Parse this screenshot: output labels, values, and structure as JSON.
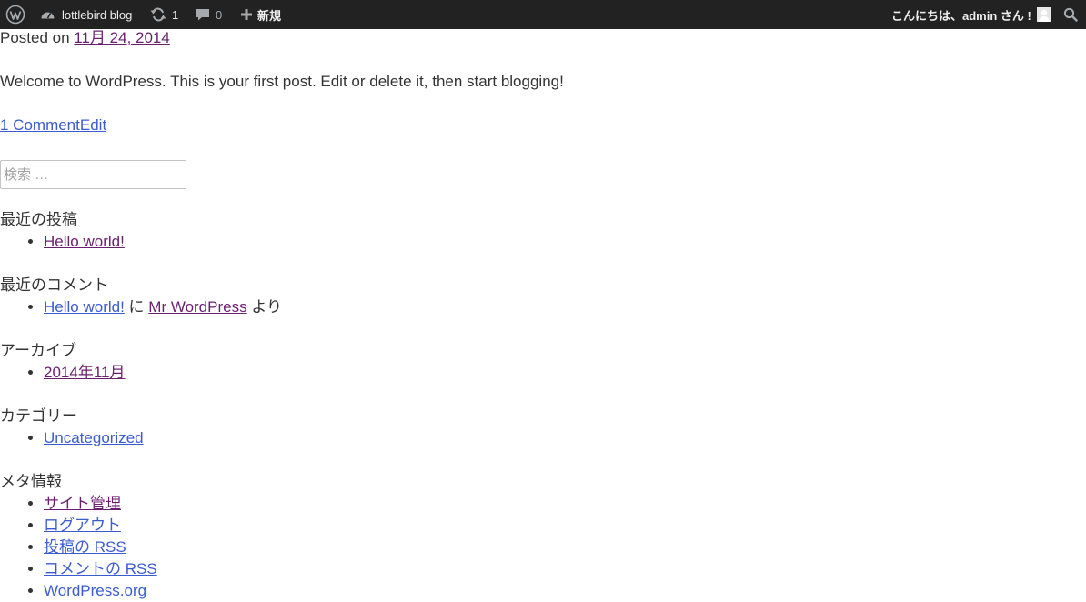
{
  "admin_bar": {
    "site_name": "lottlebird blog",
    "updates_count": "1",
    "comments_count": "0",
    "new_label": "新規",
    "greeting": "こんにちは、admin さん !"
  },
  "post": {
    "posted_on_label": "Posted on",
    "date": "11月 24, 2014",
    "body": "Welcome to WordPress. This is your first post. Edit or delete it, then start blogging!",
    "comment_link": "1 Comment",
    "edit_link": "Edit"
  },
  "search": {
    "placeholder": "検索 …"
  },
  "widgets": {
    "recent_posts": {
      "title": "最近の投稿",
      "items": [
        "Hello world!"
      ]
    },
    "recent_comments": {
      "title": "最近のコメント",
      "post_link": "Hello world!",
      "on_text": "に",
      "author_link": "Mr WordPress",
      "by_text": "より"
    },
    "archives": {
      "title": "アーカイブ",
      "items": [
        "2014年11月"
      ]
    },
    "categories": {
      "title": "カテゴリー",
      "items": [
        "Uncategorized"
      ]
    },
    "meta": {
      "title": "メタ情報",
      "items": [
        "サイト管理",
        "ログアウト",
        "投稿の RSS",
        "コメントの RSS",
        "WordPress.org"
      ]
    }
  },
  "colors": {
    "admin_bar_bg": "#222222",
    "link": "#3b5bd1",
    "visited_link": "#6b1f6f"
  }
}
